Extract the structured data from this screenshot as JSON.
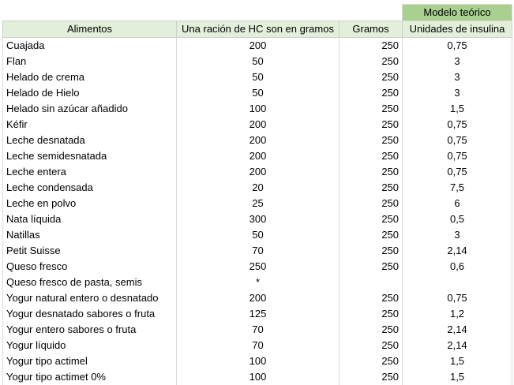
{
  "header": {
    "model_label": "Modelo teórico",
    "columns": [
      "Alimentos",
      "Una ración de HC son en gramos",
      "Gramos",
      "Unidades de insulina"
    ]
  },
  "rows": [
    {
      "food": "Cuajada",
      "portion": "200",
      "grams": "250",
      "units": "0,75"
    },
    {
      "food": "Flan",
      "portion": "50",
      "grams": "250",
      "units": "3"
    },
    {
      "food": "Helado de crema",
      "portion": "50",
      "grams": "250",
      "units": "3"
    },
    {
      "food": "Helado de Hielo",
      "portion": "50",
      "grams": "250",
      "units": "3"
    },
    {
      "food": "Helado sin azúcar añadido",
      "portion": "100",
      "grams": "250",
      "units": "1,5"
    },
    {
      "food": "Kéfir",
      "portion": "200",
      "grams": "250",
      "units": "0,75"
    },
    {
      "food": "Leche desnatada",
      "portion": "200",
      "grams": "250",
      "units": "0,75"
    },
    {
      "food": "Leche semidesnatada",
      "portion": "200",
      "grams": "250",
      "units": "0,75"
    },
    {
      "food": "Leche entera",
      "portion": "200",
      "grams": "250",
      "units": "0,75"
    },
    {
      "food": "Leche condensada",
      "portion": "20",
      "grams": "250",
      "units": "7,5"
    },
    {
      "food": "Leche en polvo",
      "portion": "25",
      "grams": "250",
      "units": "6"
    },
    {
      "food": "Nata líquida",
      "portion": "300",
      "grams": "250",
      "units": "0,5"
    },
    {
      "food": "Natillas",
      "portion": "50",
      "grams": "250",
      "units": "3"
    },
    {
      "food": "Petit Suisse",
      "portion": "70",
      "grams": "250",
      "units": "2,14"
    },
    {
      "food": "Queso fresco",
      "portion": "250",
      "grams": "250",
      "units": "0,6"
    },
    {
      "food": "Queso fresco de pasta, semis",
      "portion": "*",
      "grams": "",
      "units": ""
    },
    {
      "food": "Yogur natural entero o desnatado",
      "portion": "200",
      "grams": "250",
      "units": "0,75"
    },
    {
      "food": "Yogur desnatado sabores o fruta",
      "portion": "125",
      "grams": "250",
      "units": "1,2"
    },
    {
      "food": "Yogur entero sabores o fruta",
      "portion": "70",
      "grams": "250",
      "units": "2,14"
    },
    {
      "food": "Yogur líquido",
      "portion": "70",
      "grams": "250",
      "units": "2,14"
    },
    {
      "food": "Yogur tipo actimel",
      "portion": "100",
      "grams": "250",
      "units": "1,5"
    },
    {
      "food": "Yogur tipo actimet 0%",
      "portion": "100",
      "grams": "250",
      "units": "1,5"
    }
  ],
  "colors": {
    "model_band": "#a9d08e",
    "header_fill": "#e2efda",
    "gridline": "#d9d9d9"
  }
}
